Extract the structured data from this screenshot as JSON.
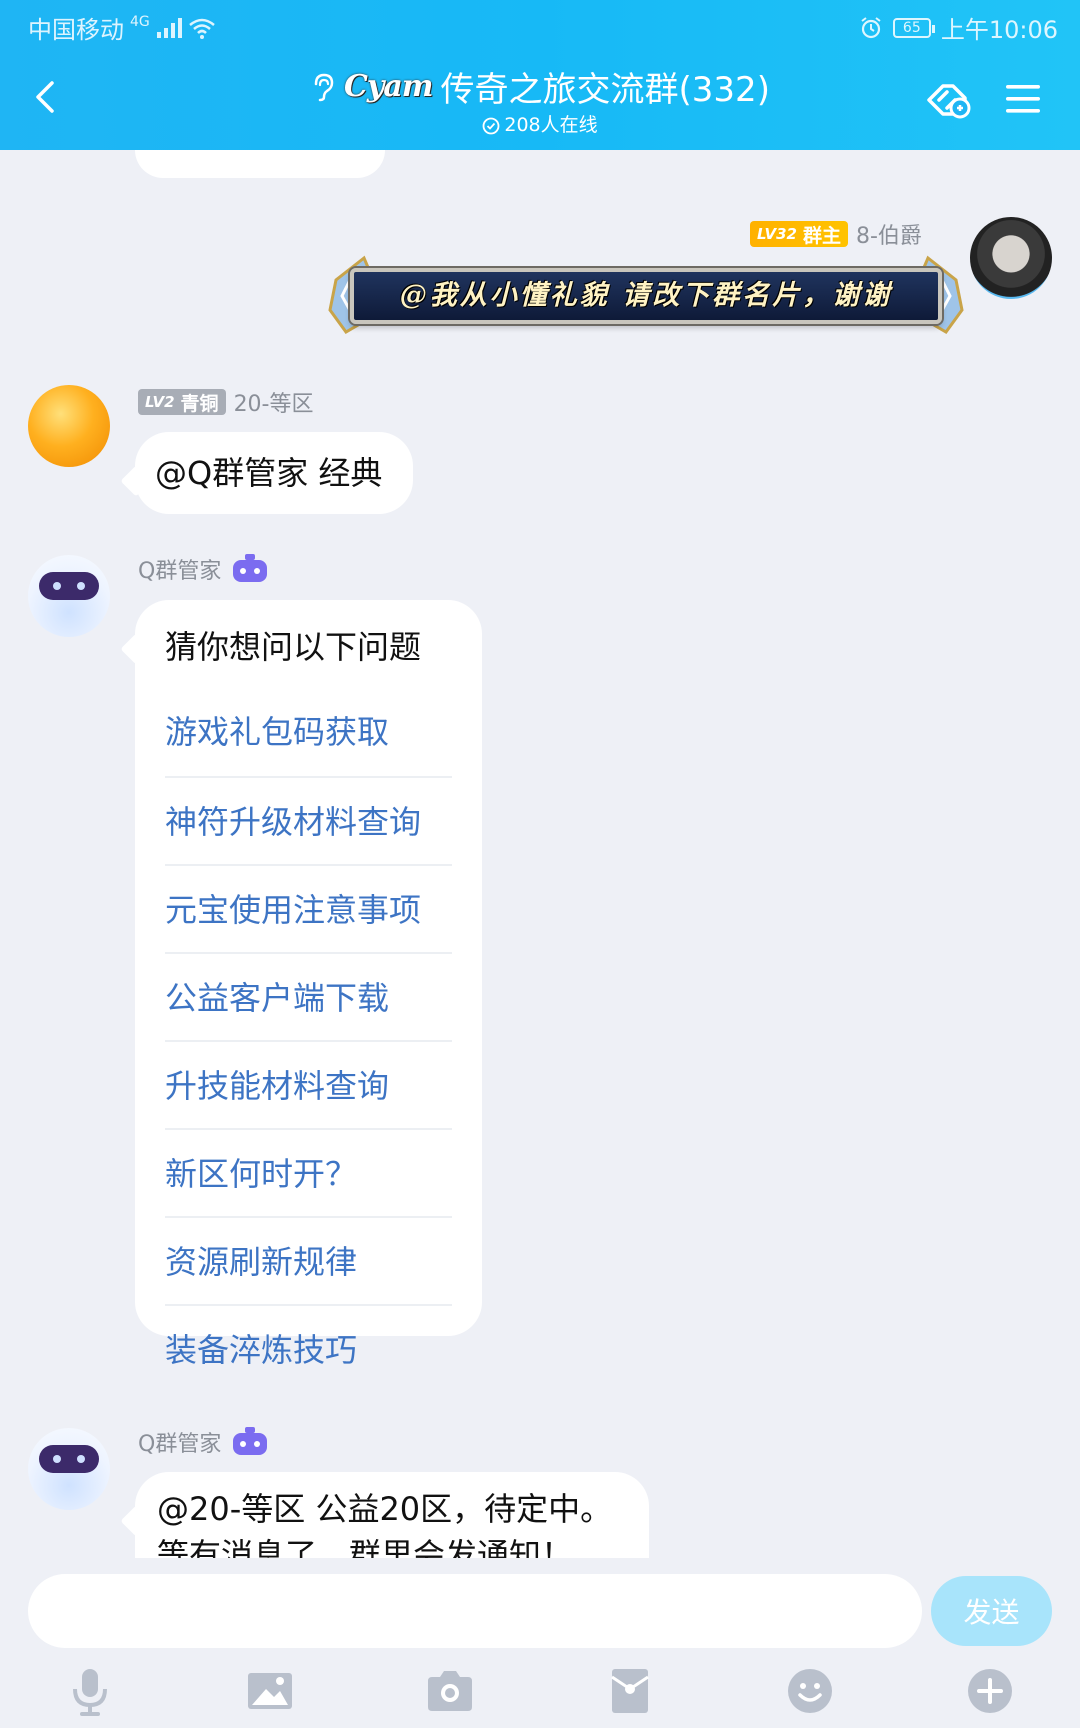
{
  "status_bar": {
    "carrier": "中国移动",
    "network": "4G",
    "battery": "65",
    "time": "上午10:06"
  },
  "header": {
    "logo_text": "Cyam",
    "group_name": "传奇之旅交流群(332)",
    "online": "208人在线"
  },
  "messages": [
    {
      "sender_name": "8-伯爵",
      "level": "LV32",
      "role": "群主",
      "banner_text": "@我从小懂礼貌 请改下群名片，谢谢"
    },
    {
      "sender_name": "20-等区",
      "level": "LV2",
      "role": "青铜",
      "text": "@Q群管家 经典"
    },
    {
      "sender_name": "Q群管家",
      "title": "猜你想问以下问题",
      "items": [
        "游戏礼包码获取",
        "神符升级材料查询",
        "元宝使用注意事项",
        "公益客户端下载",
        "升技能材料查询",
        "新区何时开？",
        "资源刷新规律",
        "装备淬炼技巧"
      ]
    },
    {
      "sender_name": "Q群管家",
      "text_line1": "@20-等区 公益20区，待定中。",
      "text_line2": "等有消息了，群里会发通知！"
    }
  ],
  "input": {
    "placeholder": "",
    "send_label": "发送"
  },
  "toolbar": {
    "icons": [
      "microphone-icon",
      "image-icon",
      "camera-icon",
      "red-packet-icon",
      "emoji-icon",
      "plus-icon"
    ]
  },
  "colors": {
    "header": "#1fb5f4",
    "link": "#3d74c4",
    "send_disabled": "#a8e4fb",
    "background": "#eef0f6"
  }
}
